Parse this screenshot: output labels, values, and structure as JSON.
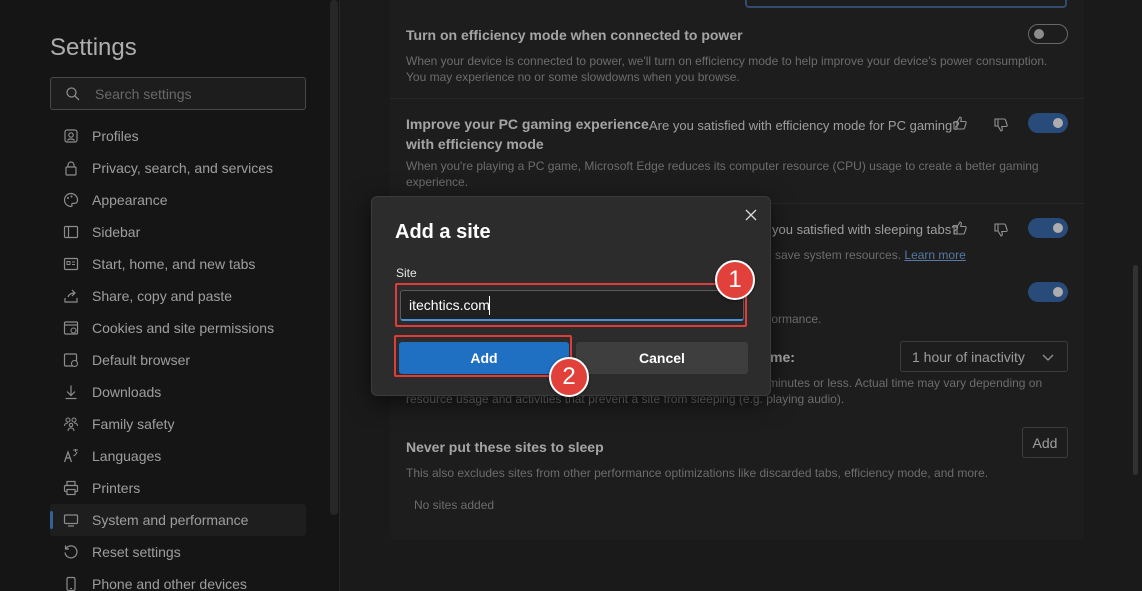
{
  "sidebar": {
    "title": "Settings",
    "search_placeholder": "Search settings",
    "items": [
      {
        "label": "Profiles",
        "icon": "profile-icon"
      },
      {
        "label": "Privacy, search, and services",
        "icon": "lock-icon"
      },
      {
        "label": "Appearance",
        "icon": "palette-icon"
      },
      {
        "label": "Sidebar",
        "icon": "sidebar-icon"
      },
      {
        "label": "Start, home, and new tabs",
        "icon": "home-icon"
      },
      {
        "label": "Share, copy and paste",
        "icon": "share-icon"
      },
      {
        "label": "Cookies and site permissions",
        "icon": "cookie-icon"
      },
      {
        "label": "Default browser",
        "icon": "browser-icon"
      },
      {
        "label": "Downloads",
        "icon": "download-icon"
      },
      {
        "label": "Family safety",
        "icon": "family-icon"
      },
      {
        "label": "Languages",
        "icon": "language-icon"
      },
      {
        "label": "Printers",
        "icon": "printer-icon"
      },
      {
        "label": "System and performance",
        "icon": "system-icon",
        "active": true
      },
      {
        "label": "Reset settings",
        "icon": "reset-icon"
      },
      {
        "label": "Phone and other devices",
        "icon": "phone-icon"
      }
    ]
  },
  "main": {
    "power": {
      "title": "Turn on efficiency mode when connected to power",
      "desc1": "When your device is connected to power, we'll turn on efficiency mode to help improve your device's power consumption.",
      "desc2": "You may experience no or some slowdowns when you browse."
    },
    "gaming": {
      "title1": "Improve your PC gaming experience",
      "title2": "with efficiency mode",
      "question": "Are you satisfied with efficiency mode for PC gaming?",
      "desc1": "When you're playing a PC game, Microsoft Edge reduces its computer resource (CPU) usage to create a better gaming",
      "desc2": "experience."
    },
    "sleeping": {
      "question": "you satisfied with sleeping tabs?",
      "desc": "save system resources.",
      "link": "Learn more"
    },
    "fade": {
      "desc": "formance."
    },
    "inactive": {
      "label": "me:",
      "select_value": "1 hour of inactivity",
      "desc1": "minutes or less. Actual time may vary depending on",
      "desc2": "resource usage and activities that prevent a site from sleeping (e.g. playing audio)."
    },
    "never": {
      "title": "Never put these sites to sleep",
      "desc": "This also excludes sites from other performance optimizations like discarded tabs, efficiency mode, and more.",
      "add_label": "Add",
      "empty": "No sites added"
    }
  },
  "dialog": {
    "title": "Add a site",
    "site_label": "Site",
    "site_value": "itechtics.com",
    "add_label": "Add",
    "cancel_label": "Cancel",
    "badge1": "1",
    "badge2": "2"
  },
  "colors": {
    "accent": "#1f6fc2",
    "highlight": "#e03c3c",
    "toggle_on": "#3d6fb4"
  }
}
